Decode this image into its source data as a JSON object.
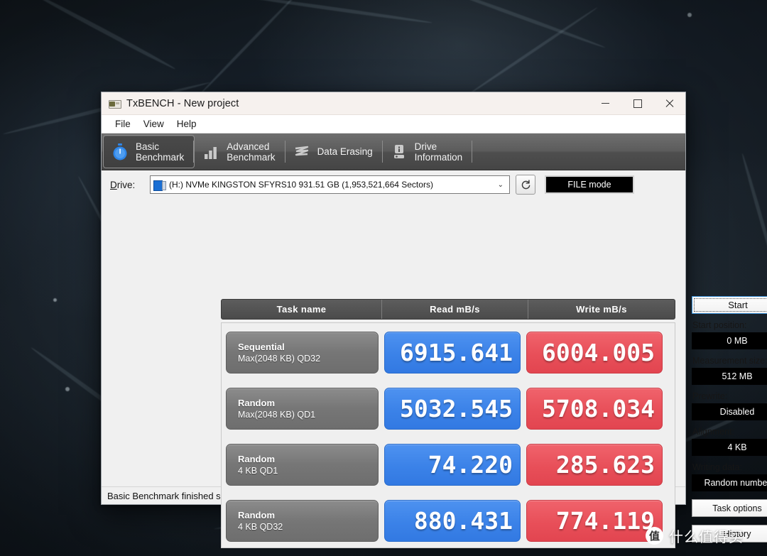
{
  "window": {
    "title": "TxBENCH - New project",
    "app_icon": "app-icon",
    "controls": {
      "minimize": "minimize",
      "maximize": "maximize",
      "close": "close"
    }
  },
  "menubar": {
    "items": [
      "File",
      "View",
      "Help"
    ]
  },
  "tabs": [
    {
      "label": "Basic\nBenchmark",
      "icon": "stopwatch-icon",
      "active": true
    },
    {
      "label": "Advanced\nBenchmark",
      "icon": "bar-chart-icon",
      "active": false
    },
    {
      "label": "Data Erasing",
      "icon": "eraser-waves-icon",
      "active": false
    },
    {
      "label": "Drive\nInformation",
      "icon": "drive-info-icon",
      "active": false
    }
  ],
  "drive": {
    "label": "Drive:",
    "label_mnemonic": "D",
    "selected": "(H:) NVMe KINGSTON SFYRS10  931.51 GB (1,953,521,664 Sectors)",
    "icon": "hard-disk-icon",
    "dropdown_icon": "chevron-down-icon",
    "refresh_icon": "refresh-icon",
    "mode_button": "FILE mode"
  },
  "table": {
    "headers": [
      "Task name",
      "Read mB/s",
      "Write mB/s"
    ],
    "rows": [
      {
        "name_line1": "Sequential",
        "name_line2": "Max(2048 KB) QD32",
        "read": "6915.641",
        "write": "6004.005"
      },
      {
        "name_line1": "Random",
        "name_line2": "Max(2048 KB) QD1",
        "read": "5032.545",
        "write": "5708.034"
      },
      {
        "name_line1": "Random",
        "name_line2": "4 KB QD1",
        "read": "74.220",
        "write": "285.623"
      },
      {
        "name_line1": "Random",
        "name_line2": "4 KB QD32",
        "read": "880.431",
        "write": "774.119"
      }
    ]
  },
  "side_panel": {
    "start_button": "Start",
    "start_position_label": "Start position:",
    "start_position_value": "0 MB",
    "measurement_size_label": "Measurement size:",
    "measurement_size_value": "512 MB",
    "prewrite_label": "Prewrite:",
    "prewrite_value": "Disabled",
    "alignment_label": "Alignment:",
    "alignment_value": "4 KB",
    "writing_data_label": "Writing data:",
    "writing_data_value": "Random number",
    "task_options_button": "Task options",
    "history_button": "History"
  },
  "statusbar": {
    "message": "Basic Benchmark finished successfully."
  },
  "watermark": {
    "logo_char": "值",
    "text": "什么值得买"
  },
  "colors": {
    "read_blue": "#3b82e8",
    "write_red": "#e84f59",
    "task_gray": "#767676",
    "value_box_black": "#000000",
    "tab_active_bg": "#444444",
    "accent_focus": "#3a8fd6"
  }
}
